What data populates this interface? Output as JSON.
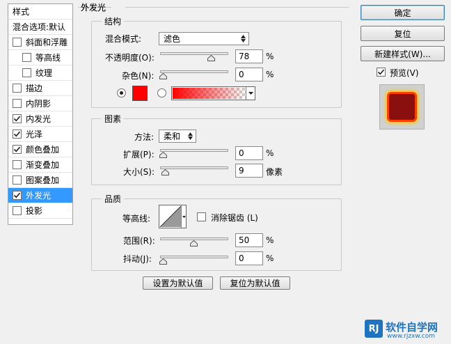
{
  "style_list": {
    "header": "样式",
    "blend_options": "混合选项:默认",
    "items": [
      {
        "label": "斜面和浮雕",
        "checked": false,
        "sub": false
      },
      {
        "label": "等高线",
        "checked": false,
        "sub": true
      },
      {
        "label": "纹理",
        "checked": false,
        "sub": true
      },
      {
        "label": "描边",
        "checked": false,
        "sub": false
      },
      {
        "label": "内阴影",
        "checked": false,
        "sub": false
      },
      {
        "label": "内发光",
        "checked": true,
        "sub": false
      },
      {
        "label": "光泽",
        "checked": true,
        "sub": false
      },
      {
        "label": "颜色叠加",
        "checked": true,
        "sub": false
      },
      {
        "label": "渐变叠加",
        "checked": false,
        "sub": false
      },
      {
        "label": "图案叠加",
        "checked": false,
        "sub": false
      },
      {
        "label": "外发光",
        "checked": true,
        "sub": false,
        "selected": true
      },
      {
        "label": "投影",
        "checked": false,
        "sub": false
      }
    ]
  },
  "panel": {
    "title": "外发光",
    "structure": {
      "title": "结构",
      "blend_mode_label": "混合模式:",
      "blend_mode_value": "滤色",
      "opacity_label": "不透明度(O):",
      "opacity_value": "78",
      "opacity_unit": "%",
      "opacity_level": 0.78,
      "noise_label": "杂色(N):",
      "noise_value": "0",
      "noise_unit": "%",
      "noise_level": 0,
      "color_swatch": "#ff0000"
    },
    "elements": {
      "title": "图素",
      "technique_label": "方法:",
      "technique_value": "柔和",
      "spread_label": "扩展(P):",
      "spread_value": "0",
      "spread_unit": "%",
      "spread_level": 0,
      "size_label": "大小(S):",
      "size_value": "9",
      "size_unit": "像素",
      "size_level": 0.036
    },
    "quality": {
      "title": "品质",
      "contour_label": "等高线:",
      "antialias_label": "消除锯齿 (L)",
      "antialias_checked": false,
      "range_label": "范围(R):",
      "range_value": "50",
      "range_unit": "%",
      "range_level": 0.5,
      "jitter_label": "抖动(J):",
      "jitter_value": "0",
      "jitter_unit": "%",
      "jitter_level": 0
    },
    "make_default": "设置为默认值",
    "reset_default": "复位为默认值"
  },
  "right": {
    "ok": "确定",
    "reset": "复位",
    "new_style": "新建样式(W)...",
    "preview_label": "预览(V)",
    "preview_checked": true
  },
  "watermark": {
    "logo_text": "RJ",
    "site_name": "软件自学网",
    "url": "www.rjzxw.com"
  }
}
